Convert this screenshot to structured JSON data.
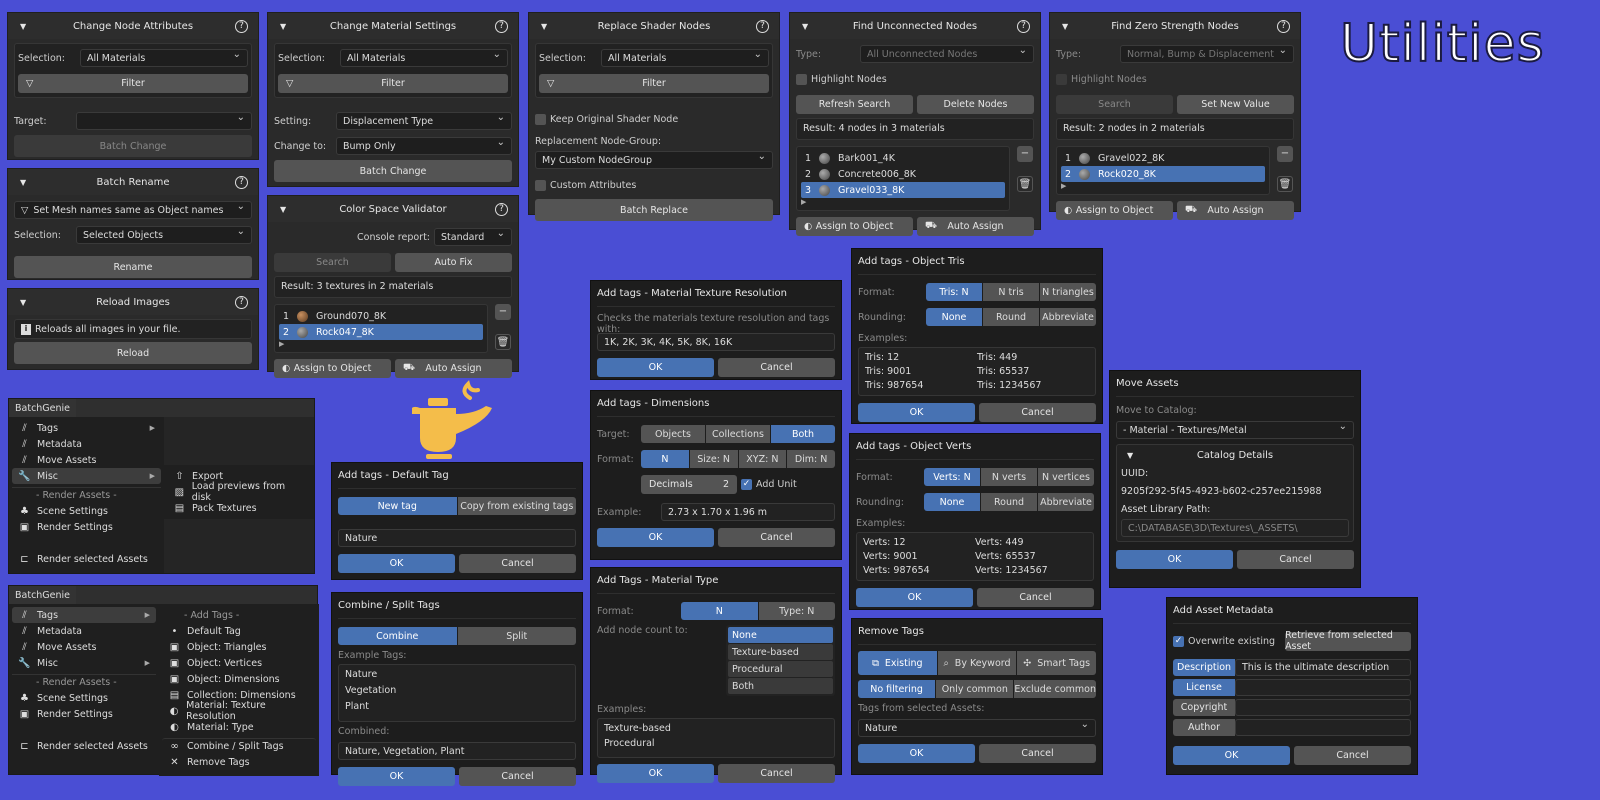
{
  "title": "Utilities",
  "cna": {
    "title": "Change Node Attributes",
    "selection_label": "Selection:",
    "selection": "All Materials",
    "filter": "Filter",
    "target_label": "Target:",
    "target": "",
    "batch": "Batch Change"
  },
  "br": {
    "title": "Batch Rename",
    "mode": "Set Mesh names same as Object names",
    "selection_label": "Selection:",
    "selection": "Selected Objects",
    "rename": "Rename"
  },
  "ri": {
    "title": "Reload Images",
    "info": "Reloads all images in your file.",
    "reload": "Reload"
  },
  "cms": {
    "title": "Change Material Settings",
    "selection_label": "Selection:",
    "selection": "All Materials",
    "filter": "Filter",
    "setting_label": "Setting:",
    "setting": "Displacement Type",
    "change_label": "Change to:",
    "change": "Bump Only",
    "batch": "Batch Change"
  },
  "csv": {
    "title": "Color Space Validator",
    "console_label": "Console report:",
    "console": "Standard",
    "search": "Search",
    "autofix": "Auto Fix",
    "result": "Result: 3 textures in 2 materials",
    "items": [
      {
        "n": "1",
        "name": "Ground070_8K"
      },
      {
        "n": "2",
        "name": "Rock047_8K"
      }
    ],
    "assign": "Assign to Object",
    "auto": "Auto Assign"
  },
  "rsn": {
    "title": "Replace Shader Nodes",
    "selection_label": "Selection:",
    "selection": "All Materials",
    "filter": "Filter",
    "keep": "Keep Original Shader Node",
    "repl_label": "Replacement Node-Group:",
    "repl": "My Custom NodeGroup",
    "custom": "Custom Attributes",
    "replace": "Batch Replace"
  },
  "fun": {
    "title": "Find Unconnected Nodes",
    "type_label": "Type:",
    "type": "All Unconnected Nodes",
    "highlight": "Highlight Nodes",
    "refresh": "Refresh Search",
    "delete": "Delete Nodes",
    "result": "Result: 4 nodes in 3 materials",
    "items": [
      {
        "n": "1",
        "name": "Bark001_4K"
      },
      {
        "n": "2",
        "name": "Concrete006_8K"
      },
      {
        "n": "3",
        "name": "Gravel033_8K"
      }
    ],
    "assign": "Assign to Object",
    "auto": "Auto Assign"
  },
  "fzs": {
    "title": "Find Zero Strength Nodes",
    "type_label": "Type:",
    "type": "Normal, Bump & Displacement",
    "highlight": "Highlight Nodes",
    "search": "Search",
    "setnew": "Set New Value",
    "result": "Result: 2 nodes in 2 materials",
    "items": [
      {
        "n": "1",
        "name": "Gravel022_8K"
      },
      {
        "n": "2",
        "name": "Rock020_8K"
      }
    ],
    "assign": "Assign to Object",
    "auto": "Auto Assign"
  },
  "menu1": {
    "tab": "BatchGenie",
    "items": [
      "Tags",
      "Metadata",
      "Move Assets",
      "Misc"
    ],
    "section": "- Render Assets -",
    "render": [
      "Scene Settings",
      "Render Settings"
    ],
    "render_sel": "Render selected Assets",
    "sub": [
      "Export",
      "Load previews from disk",
      "Pack Textures"
    ]
  },
  "menu2": {
    "tab": "BatchGenie",
    "items": [
      "Tags",
      "Metadata",
      "Move Assets",
      "Misc"
    ],
    "section": "- Render Assets -",
    "render": [
      "Scene Settings",
      "Render Settings"
    ],
    "render_sel": "Render selected Assets",
    "sub_section": "- Add Tags -",
    "sub": [
      "Default Tag",
      "Object: Triangles",
      "Object: Vertices",
      "Object: Dimensions",
      "Collection: Dimensions",
      "Material: Texture Resolution",
      "Material: Type",
      "Combine / Split Tags",
      "Remove Tags"
    ]
  },
  "dt": {
    "title": "Add tags - Default Tag",
    "tabs": [
      "New tag",
      "Copy from existing tags"
    ],
    "value": "Nature",
    "ok": "OK",
    "cancel": "Cancel"
  },
  "cs": {
    "title": "Combine / Split Tags",
    "tabs": [
      "Combine",
      "Split"
    ],
    "ex_label": "Example Tags:",
    "examples": [
      "Nature",
      "Vegetation",
      "Plant"
    ],
    "comb_label": "Combined:",
    "combined": "Nature, Vegetation, Plant",
    "ok": "OK",
    "cancel": "Cancel"
  },
  "mtr": {
    "title": "Add tags - Material Texture Resolution",
    "desc": "Checks the materials texture resolution and tags with:",
    "value": "1K, 2K, 3K, 4K, 5K, 8K, 16K",
    "ok": "OK",
    "cancel": "Cancel"
  },
  "dim": {
    "title": "Add tags - Dimensions",
    "target_label": "Target:",
    "targets": [
      "Objects",
      "Collections",
      "Both"
    ],
    "format_label": "Format:",
    "formats": [
      "N",
      "Size: N",
      "XYZ: N",
      "Dim: N"
    ],
    "decimals_label": "Decimals",
    "decimals": "2",
    "unit": "Add Unit",
    "ex_label": "Example:",
    "example": "2.73 x 1.70 x 1.96 m",
    "ok": "OK",
    "cancel": "Cancel"
  },
  "mt": {
    "title": "Add Tags - Material Type",
    "format_label": "Format:",
    "formats": [
      "N",
      "Type: N"
    ],
    "count_label": "Add node count to:",
    "options": [
      "None",
      "Texture-based",
      "Procedural",
      "Both"
    ],
    "ex_label": "Examples:",
    "examples": [
      "Texture-based",
      "Procedural"
    ],
    "ok": "OK",
    "cancel": "Cancel"
  },
  "tris": {
    "title": "Add tags - Object Tris",
    "format_label": "Format:",
    "formats": [
      "Tris: N",
      "N tris",
      "N triangles"
    ],
    "round_label": "Rounding:",
    "rounds": [
      "None",
      "Round",
      "Abbreviate"
    ],
    "ex_label": "Examples:",
    "examples": [
      "Tris: 12",
      "Tris: 449",
      "Tris: 9001",
      "Tris: 65537",
      "Tris: 987654",
      "Tris: 1234567"
    ],
    "ok": "OK",
    "cancel": "Cancel"
  },
  "verts": {
    "title": "Add tags - Object Verts",
    "format_label": "Format:",
    "formats": [
      "Verts: N",
      "N verts",
      "N vertices"
    ],
    "round_label": "Rounding:",
    "rounds": [
      "None",
      "Round",
      "Abbreviate"
    ],
    "ex_label": "Examples:",
    "examples": [
      "Verts: 12",
      "Verts: 449",
      "Verts: 9001",
      "Verts: 65537",
      "Verts: 987654",
      "Verts: 1234567"
    ],
    "ok": "OK",
    "cancel": "Cancel"
  },
  "rt": {
    "title": "Remove Tags",
    "modes": [
      "Existing",
      "By Keyword",
      "Smart Tags"
    ],
    "filters": [
      "No filtering",
      "Only common",
      "Exclude common"
    ],
    "from_label": "Tags from selected Assets:",
    "value": "Nature",
    "ok": "OK",
    "cancel": "Cancel"
  },
  "ma": {
    "title": "Move Assets",
    "cat_label": "Move to Catalog:",
    "catalog": "- Material - Textures/Metal",
    "details": "Catalog Details",
    "uuid_label": "UUID:",
    "uuid": "9205f292-5f45-4923-b602-c257ee215988",
    "path_label": "Asset Library Path:",
    "path": "C:\\DATABASE\\3D\\Textures\\_ASSETS\\",
    "ok": "OK",
    "cancel": "Cancel"
  },
  "am": {
    "title": "Add Asset Metadata",
    "overwrite": "Overwrite existing",
    "retrieve": "Retrieve from selected Asset",
    "fields": [
      {
        "k": "Description",
        "v": "This is the ultimate description"
      },
      {
        "k": "License",
        "v": ""
      },
      {
        "k": "Copyright",
        "v": ""
      },
      {
        "k": "Author",
        "v": ""
      }
    ],
    "ok": "OK",
    "cancel": "Cancel"
  }
}
